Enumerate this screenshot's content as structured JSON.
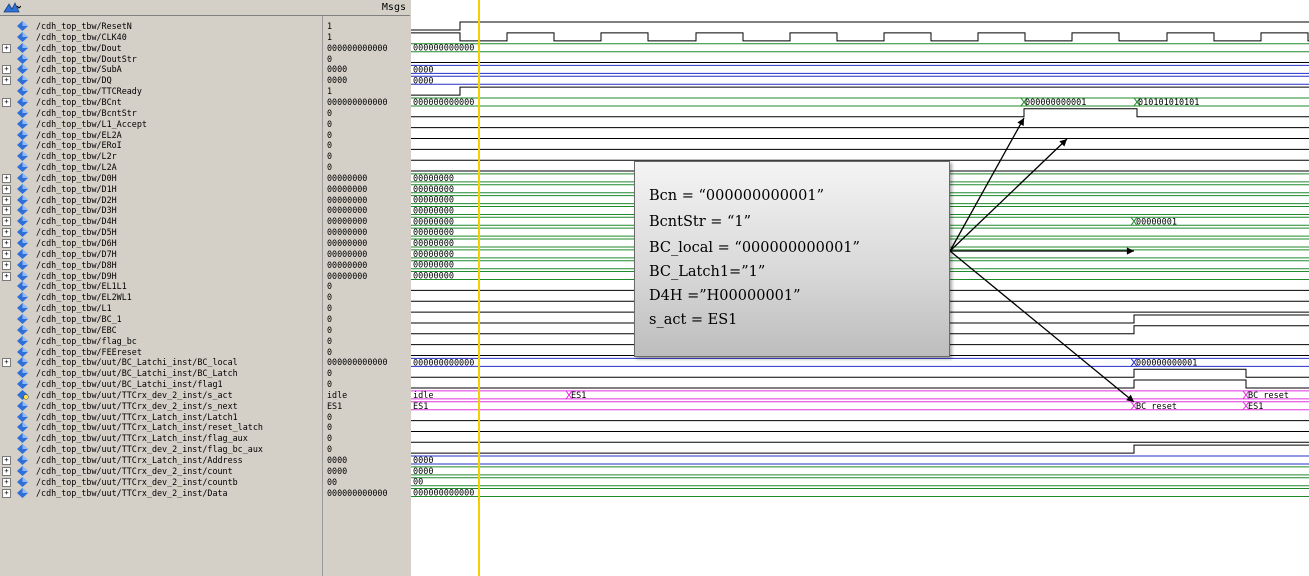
{
  "header": {
    "msgs_label": "Msgs",
    "toolbar_icon": "wave-cursor-icon"
  },
  "signals": [
    {
      "name": "/cdh_top_tbw/ResetN",
      "value": "1",
      "expandable": false,
      "icon": "signal-diamond-icon"
    },
    {
      "name": "/cdh_top_tbw/CLK40",
      "value": "1",
      "expandable": false,
      "icon": "signal-diamond-icon"
    },
    {
      "name": "/cdh_top_tbw/Dout",
      "value": "000000000000",
      "expandable": true,
      "icon": "signal-diamond-icon"
    },
    {
      "name": "/cdh_top_tbw/DoutStr",
      "value": "0",
      "expandable": false,
      "icon": "signal-diamond-icon"
    },
    {
      "name": "/cdh_top_tbw/SubA",
      "value": "0000",
      "expandable": true,
      "icon": "signal-diamond-icon"
    },
    {
      "name": "/cdh_top_tbw/DQ",
      "value": "0000",
      "expandable": true,
      "icon": "signal-diamond-icon"
    },
    {
      "name": "/cdh_top_tbw/TTCReady",
      "value": "1",
      "expandable": false,
      "icon": "signal-diamond-icon"
    },
    {
      "name": "/cdh_top_tbw/BCnt",
      "value": "000000000000",
      "expandable": true,
      "icon": "signal-diamond-icon"
    },
    {
      "name": "/cdh_top_tbw/BcntStr",
      "value": "0",
      "expandable": false,
      "icon": "signal-diamond-icon"
    },
    {
      "name": "/cdh_top_tbw/L1_Accept",
      "value": "0",
      "expandable": false,
      "icon": "signal-diamond-icon"
    },
    {
      "name": "/cdh_top_tbw/EL2A",
      "value": "0",
      "expandable": false,
      "icon": "signal-diamond-icon"
    },
    {
      "name": "/cdh_top_tbw/ERoI",
      "value": "0",
      "expandable": false,
      "icon": "signal-diamond-icon"
    },
    {
      "name": "/cdh_top_tbw/L2r",
      "value": "0",
      "expandable": false,
      "icon": "signal-diamond-icon"
    },
    {
      "name": "/cdh_top_tbw/L2A",
      "value": "0",
      "expandable": false,
      "icon": "signal-diamond-icon"
    },
    {
      "name": "/cdh_top_tbw/D0H",
      "value": "00000000",
      "expandable": true,
      "icon": "signal-diamond-icon"
    },
    {
      "name": "/cdh_top_tbw/D1H",
      "value": "00000000",
      "expandable": true,
      "icon": "signal-diamond-icon"
    },
    {
      "name": "/cdh_top_tbw/D2H",
      "value": "00000000",
      "expandable": true,
      "icon": "signal-diamond-icon"
    },
    {
      "name": "/cdh_top_tbw/D3H",
      "value": "00000000",
      "expandable": true,
      "icon": "signal-diamond-icon"
    },
    {
      "name": "/cdh_top_tbw/D4H",
      "value": "00000000",
      "expandable": true,
      "icon": "signal-diamond-icon"
    },
    {
      "name": "/cdh_top_tbw/D5H",
      "value": "00000000",
      "expandable": true,
      "icon": "signal-diamond-icon"
    },
    {
      "name": "/cdh_top_tbw/D6H",
      "value": "00000000",
      "expandable": true,
      "icon": "signal-diamond-icon"
    },
    {
      "name": "/cdh_top_tbw/D7H",
      "value": "00000000",
      "expandable": true,
      "icon": "signal-diamond-icon"
    },
    {
      "name": "/cdh_top_tbw/D8H",
      "value": "00000000",
      "expandable": true,
      "icon": "signal-diamond-icon"
    },
    {
      "name": "/cdh_top_tbw/D9H",
      "value": "00000000",
      "expandable": true,
      "icon": "signal-diamond-icon"
    },
    {
      "name": "/cdh_top_tbw/EL1L1",
      "value": "0",
      "expandable": false,
      "icon": "signal-diamond-icon"
    },
    {
      "name": "/cdh_top_tbw/EL2WL1",
      "value": "0",
      "expandable": false,
      "icon": "signal-diamond-icon"
    },
    {
      "name": "/cdh_top_tbw/L1",
      "value": "0",
      "expandable": false,
      "icon": "signal-diamond-icon"
    },
    {
      "name": "/cdh_top_tbw/BC_1",
      "value": "0",
      "expandable": false,
      "icon": "signal-diamond-icon"
    },
    {
      "name": "/cdh_top_tbw/EBC",
      "value": "0",
      "expandable": false,
      "icon": "signal-diamond-icon"
    },
    {
      "name": "/cdh_top_tbw/flag_bc",
      "value": "0",
      "expandable": false,
      "icon": "signal-diamond-icon"
    },
    {
      "name": "/cdh_top_tbw/FEEreset",
      "value": "0",
      "expandable": false,
      "icon": "signal-diamond-icon"
    },
    {
      "name": "/cdh_top_tbw/uut/BC_Latchi_inst/BC_local",
      "value": "000000000000",
      "expandable": true,
      "icon": "signal-diamond-icon"
    },
    {
      "name": "/cdh_top_tbw/uut/BC_Latchi_inst/BC_Latch",
      "value": "0",
      "expandable": false,
      "icon": "signal-diamond-icon"
    },
    {
      "name": "/cdh_top_tbw/uut/BC_Latchi_inst/flag1",
      "value": "0",
      "expandable": false,
      "icon": "signal-diamond-icon"
    },
    {
      "name": "/cdh_top_tbw/uut/TTCrx_dev_2_inst/s_act",
      "value": "idle",
      "expandable": false,
      "icon": "state-machine-icon"
    },
    {
      "name": "/cdh_top_tbw/uut/TTCrx_dev_2_inst/s_next",
      "value": "ES1",
      "expandable": false,
      "icon": "signal-diamond-icon"
    },
    {
      "name": "/cdh_top_tbw/uut/TTCrx_Latch_inst/Latch1",
      "value": "0",
      "expandable": false,
      "icon": "signal-diamond-icon"
    },
    {
      "name": "/cdh_top_tbw/uut/TTCrx_Latch_inst/reset_latch",
      "value": "0",
      "expandable": false,
      "icon": "signal-diamond-icon"
    },
    {
      "name": "/cdh_top_tbw/uut/TTCrx_Latch_inst/flag_aux",
      "value": "0",
      "expandable": false,
      "icon": "signal-diamond-icon"
    },
    {
      "name": "/cdh_top_tbw/uut/TTCrx_dev_2_inst/flag_bc_aux",
      "value": "0",
      "expandable": false,
      "icon": "signal-diamond-icon"
    },
    {
      "name": "/cdh_top_tbw/uut/TTCrx_Latch_inst/Address",
      "value": "0000",
      "expandable": true,
      "icon": "signal-diamond-icon"
    },
    {
      "name": "/cdh_top_tbw/uut/TTCrx_dev_2_inst/count",
      "value": "0000",
      "expandable": true,
      "icon": "signal-diamond-icon"
    },
    {
      "name": "/cdh_top_tbw/uut/TTCrx_dev_2_inst/countb",
      "value": "00",
      "expandable": true,
      "icon": "signal-diamond-icon"
    },
    {
      "name": "/cdh_top_tbw/uut/TTCrx_dev_2_inst/Data",
      "value": "000000000000",
      "expandable": true,
      "icon": "signal-diamond-icon"
    }
  ],
  "wave_labels": {
    "dout": "000000000000",
    "suba": "0000",
    "dq": "0000",
    "bcnt_initial": "000000000000",
    "bcnt_change1": "000000000001",
    "bcnt_change2": "010101010101",
    "dh_initial": "00000000",
    "d4h_change": "00000001",
    "bc_local_initial": "000000000000",
    "bc_local_change": "000000000001",
    "s_act_idle": "idle",
    "s_act_es1": "ES1",
    "s_act_bc_reset": "BC reset",
    "s_next_es1": "ES1",
    "s_next_bc_reset": "BC reset",
    "s_next_es1_end": "ES1",
    "address": "0000",
    "count": "0000",
    "countb": "00",
    "data": "000000000000"
  },
  "callout": {
    "lines": [
      "Bcn        = “000000000001”",
      "BcntStr   = “1”",
      "BC_local  = “000000000001”",
      "BC_Latch1=”1”",
      "D4H        =”H00000001”",
      "s_act       = ES1"
    ]
  },
  "colors": {
    "panel": "#d4d0c8",
    "bus": "#1f8a2a",
    "bus_blue": "#2330c8",
    "logic": "#000000",
    "state": "#e030e0",
    "cursor": "#f5d000",
    "diamond": "#2f6fd8"
  }
}
